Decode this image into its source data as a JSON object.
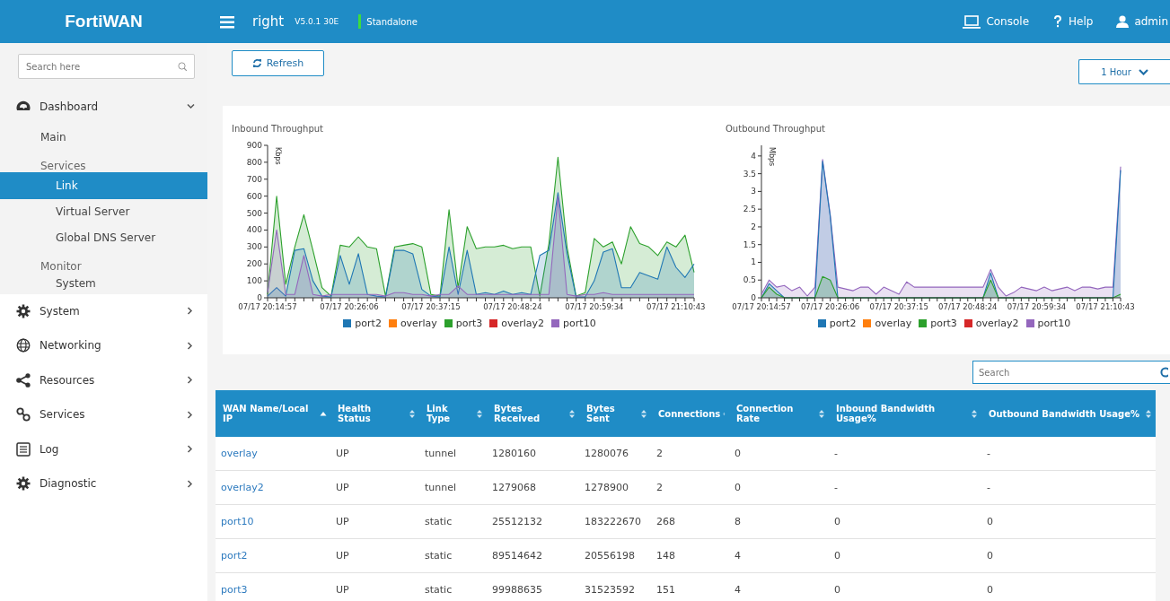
{
  "topbar": {
    "logo": "FortiWAN",
    "hostname": "right",
    "version": "V5.0.1 30E",
    "mode": "Standalone",
    "links": [
      {
        "label": "Console"
      },
      {
        "label": "Help"
      },
      {
        "label": "admin"
      }
    ]
  },
  "sidebar": {
    "search": {
      "placeholder": "Search here"
    },
    "items": [
      {
        "label": "Dashboard",
        "expanded": true,
        "children": [
          {
            "label": "Main",
            "selected": false
          },
          {
            "label": "Services",
            "kind": "group",
            "children": [
              {
                "label": "Link",
                "selected": true
              },
              {
                "label": "Virtual Server",
                "selected": false
              },
              {
                "label": "Global DNS Server",
                "selected": false
              }
            ]
          },
          {
            "label": "Monitor",
            "kind": "group",
            "children": [
              {
                "label": "System",
                "selected": false
              }
            ]
          }
        ]
      },
      {
        "label": "System",
        "expanded": false
      },
      {
        "label": "Networking",
        "expanded": false
      },
      {
        "label": "Resources",
        "expanded": false
      },
      {
        "label": "Services",
        "expanded": false
      },
      {
        "label": "Log",
        "expanded": false
      },
      {
        "label": "Diagnostic",
        "expanded": false
      }
    ]
  },
  "toolbar": {
    "refresh": "Refresh",
    "range": "1 Hour"
  },
  "charts": [
    {
      "chart_data": {
        "type": "area",
        "title": "Inbound Throughput",
        "ylabel": "Kbps",
        "legend": "bottom",
        "categories": [
          "07/17 20:14:57",
          null,
          null,
          null,
          null,
          null,
          null,
          null,
          null,
          "07/17 20:26:06",
          null,
          null,
          null,
          null,
          null,
          null,
          null,
          null,
          "07/17 20:37:15",
          null,
          null,
          null,
          null,
          null,
          null,
          null,
          null,
          "07/17 20:48:24",
          null,
          null,
          null,
          null,
          null,
          null,
          null,
          null,
          "07/17 20:59:34",
          null,
          null,
          null,
          null,
          null,
          null,
          null,
          null,
          "07/17 21:10:43",
          null,
          null
        ],
        "ylim": [
          0,
          900
        ],
        "yticks": [
          0,
          100,
          200,
          300,
          400,
          500,
          600,
          700,
          800,
          900
        ],
        "series": [
          {
            "name": "port2",
            "color": "#1f77b4",
            "values": [
              10,
              60,
              10,
              280,
              290,
              100,
              10,
              5,
              250,
              80,
              260,
              20,
              10,
              5,
              280,
              280,
              260,
              50,
              10,
              5,
              300,
              20,
              280,
              20,
              30,
              20,
              40,
              20,
              30,
              20,
              250,
              280,
              620,
              260,
              5,
              5,
              100,
              270,
              290,
              60,
              60,
              150,
              130,
              110,
              300,
              180,
              120,
              200
            ]
          },
          {
            "name": "overlay",
            "color": "#ff7f0e",
            "values": [
              null,
              null,
              null,
              null,
              null,
              null,
              null,
              null,
              null,
              null,
              null,
              null,
              null,
              null,
              null,
              null,
              null,
              null,
              null,
              null,
              null,
              null,
              null,
              null,
              null,
              null,
              null,
              null,
              null,
              null,
              null,
              null,
              null,
              null,
              null,
              null,
              null,
              null,
              null,
              null,
              null,
              null,
              null,
              null,
              null,
              null,
              null,
              null
            ]
          },
          {
            "name": "port3",
            "color": "#2ca02c",
            "values": [
              20,
              600,
              80,
              300,
              490,
              280,
              60,
              10,
              310,
              300,
              360,
              300,
              290,
              10,
              300,
              310,
              320,
              300,
              20,
              10,
              520,
              60,
              420,
              290,
              300,
              300,
              310,
              290,
              300,
              300,
              10,
              320,
              830,
              300,
              10,
              30,
              350,
              300,
              330,
              200,
              420,
              320,
              300,
              250,
              330,
              300,
              370,
              150
            ]
          },
          {
            "name": "overlay2",
            "color": "#d62728",
            "values": [
              null,
              null,
              null,
              null,
              null,
              null,
              null,
              null,
              null,
              null,
              null,
              null,
              null,
              null,
              null,
              null,
              null,
              null,
              null,
              null,
              null,
              null,
              null,
              null,
              null,
              null,
              null,
              null,
              null,
              null,
              null,
              null,
              null,
              null,
              null,
              null,
              null,
              null,
              null,
              null,
              null,
              null,
              null,
              null,
              null,
              null,
              null,
              null
            ]
          },
          {
            "name": "port10",
            "color": "#9467bd",
            "values": [
              30,
              400,
              20,
              20,
              250,
              20,
              10,
              20,
              20,
              20,
              20,
              20,
              20,
              10,
              30,
              30,
              20,
              20,
              10,
              20,
              20,
              70,
              20,
              20,
              20,
              20,
              20,
              20,
              20,
              20,
              20,
              20,
              600,
              20,
              10,
              20,
              20,
              30,
              20,
              20,
              20,
              20,
              20,
              20,
              20,
              20,
              20,
              20
            ]
          }
        ]
      }
    },
    {
      "chart_data": {
        "type": "area",
        "title": "Outbound Throughput",
        "ylabel": "Mbps",
        "legend": "bottom",
        "categories": [
          "07/17 20:14:57",
          null,
          null,
          null,
          null,
          null,
          null,
          null,
          null,
          "07/17 20:26:06",
          null,
          null,
          null,
          null,
          null,
          null,
          null,
          null,
          "07/17 20:37:15",
          null,
          null,
          null,
          null,
          null,
          null,
          null,
          null,
          "07/17 20:48:24",
          null,
          null,
          null,
          null,
          null,
          null,
          null,
          null,
          "07/17 20:59:34",
          null,
          null,
          null,
          null,
          null,
          null,
          null,
          null,
          "07/17 21:10:43",
          null,
          null
        ],
        "ylim": [
          0,
          4.3
        ],
        "yticks": [
          0,
          0.5,
          1,
          1.5,
          2,
          2.5,
          3,
          3.5,
          4
        ],
        "series": [
          {
            "name": "port2",
            "color": "#1f77b4",
            "values": [
              0,
              0.4,
              0.2,
              0,
              0,
              0,
              0,
              0,
              3.85,
              2.3,
              0,
              0,
              0,
              0,
              0,
              0,
              0,
              0,
              0,
              0,
              0,
              0,
              0,
              0,
              0,
              0,
              0,
              0,
              0,
              0,
              0.7,
              0,
              0,
              0,
              0,
              0,
              0,
              0,
              0,
              0,
              0,
              0,
              0,
              0,
              0,
              0,
              0,
              3.6
            ]
          },
          {
            "name": "overlay",
            "color": "#ff7f0e",
            "values": [
              null,
              null,
              null,
              null,
              null,
              null,
              null,
              null,
              null,
              null,
              null,
              null,
              null,
              null,
              null,
              null,
              null,
              null,
              null,
              null,
              null,
              null,
              null,
              null,
              null,
              null,
              null,
              null,
              null,
              null,
              null,
              null,
              null,
              null,
              null,
              null,
              null,
              null,
              null,
              null,
              null,
              null,
              null,
              null,
              null,
              null,
              null,
              null
            ]
          },
          {
            "name": "port3",
            "color": "#2ca02c",
            "values": [
              0,
              0.3,
              0.1,
              0,
              0,
              0,
              0,
              0,
              0.6,
              0.5,
              0,
              0,
              0,
              0,
              0,
              0,
              0,
              0,
              0,
              0,
              0,
              0,
              0,
              0,
              0,
              0,
              0,
              0,
              0,
              0,
              0.5,
              0,
              0,
              0,
              0,
              0,
              0,
              0,
              0,
              0,
              0,
              0,
              0,
              0,
              0,
              0,
              0,
              0.1
            ]
          },
          {
            "name": "overlay2",
            "color": "#d62728",
            "values": [
              null,
              null,
              null,
              null,
              null,
              null,
              null,
              null,
              null,
              null,
              null,
              null,
              null,
              null,
              null,
              null,
              null,
              null,
              null,
              null,
              null,
              null,
              null,
              null,
              null,
              null,
              null,
              null,
              null,
              null,
              null,
              null,
              null,
              null,
              null,
              null,
              null,
              null,
              null,
              null,
              null,
              null,
              null,
              null,
              null,
              null,
              null,
              null
            ]
          },
          {
            "name": "port10",
            "color": "#9467bd",
            "values": [
              0.1,
              0.5,
              0.3,
              0.35,
              0.2,
              0.3,
              0.05,
              0.3,
              3.9,
              2.35,
              0.3,
              0.25,
              0.2,
              0.3,
              0.3,
              0.1,
              0.3,
              0.2,
              0.1,
              0.45,
              0.3,
              0.3,
              0.3,
              0.3,
              0.3,
              0.3,
              0.3,
              0.3,
              0.3,
              0.3,
              0.8,
              0.3,
              0.05,
              0.15,
              0.3,
              0.25,
              0.2,
              0.3,
              0.2,
              0.25,
              0.3,
              0.2,
              0.3,
              0.3,
              0.25,
              0.3,
              0.3,
              3.7
            ]
          }
        ]
      }
    }
  ],
  "table": {
    "search": {
      "placeholder": "Search"
    },
    "columns": [
      {
        "label": "WAN Name/Local IP",
        "sorted_ascending": true
      },
      {
        "label": "Health Status",
        "sorted_ascending": false
      },
      {
        "label": "Link Type",
        "sorted_ascending": false
      },
      {
        "label": "Bytes Received",
        "sorted_ascending": false
      },
      {
        "label": "Bytes Sent",
        "sorted_ascending": false
      },
      {
        "label": "Connections",
        "sorted_ascending": false
      },
      {
        "label": "Connection Rate",
        "sorted_ascending": false
      },
      {
        "label": "Inbound Bandwidth Usage%",
        "sorted_ascending": false
      },
      {
        "label": "Outbound Bandwidth Usage%",
        "sorted_ascending": false
      }
    ],
    "rows": [
      [
        "overlay",
        "UP",
        "tunnel",
        "1280160",
        "1280076",
        "2",
        "0",
        "-",
        "-"
      ],
      [
        "overlay2",
        "UP",
        "tunnel",
        "1279068",
        "1278900",
        "2",
        "0",
        "-",
        "-"
      ],
      [
        "port10",
        "UP",
        "static",
        "25512132",
        "183222670",
        "268",
        "8",
        "0",
        "0"
      ],
      [
        "port2",
        "UP",
        "static",
        "89514642",
        "20556198",
        "148",
        "4",
        "0",
        "0"
      ],
      [
        "port3",
        "UP",
        "static",
        "99988635",
        "31523592",
        "151",
        "4",
        "0",
        "0"
      ]
    ]
  }
}
